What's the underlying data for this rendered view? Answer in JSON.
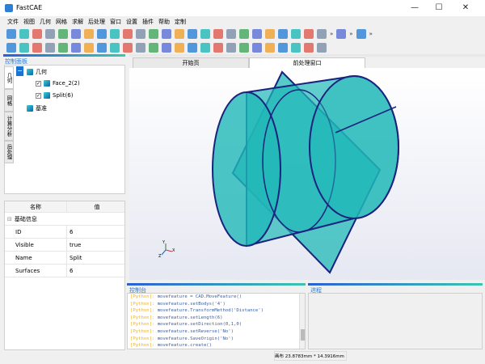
{
  "window": {
    "title": "FastCAE",
    "minimize": "—",
    "maximize": "☐",
    "close": "✕"
  },
  "menu": [
    "文件",
    "视图",
    "几何",
    "网格",
    "求解",
    "后处理",
    "窗口",
    "设置",
    "插件",
    "帮助",
    "定制"
  ],
  "toolbar1": [
    "new-file",
    "open-folder",
    "save",
    "import-geometry",
    "export-mesh",
    "calculator",
    "fit-view",
    "view-xy",
    "view-yx",
    "view-xz",
    "view-zx",
    "view-yz",
    "view-zy",
    "display-surface",
    "display-points",
    "display-edges",
    "display-faces",
    "select-point",
    "select-line",
    "select-face",
    "select-body",
    "box-select",
    "box-select-2",
    "grid-toggle",
    "cube-outline",
    "more",
    "mesh-cube",
    "more",
    "undo",
    "more"
  ],
  "toolbar2": [
    "sketch",
    "box",
    "cylinder",
    "cone",
    "sphere",
    "plane-triangle",
    "line",
    "points",
    "plane",
    "chamfer",
    "fillet",
    "variable-fillet",
    "boolean-union",
    "boolean-cut",
    "boolean-common",
    "mirror",
    "move",
    "rotate",
    "array",
    "extrude",
    "loft",
    "sweep",
    "revolve",
    "split",
    "measure"
  ],
  "left": {
    "title": "控制面板",
    "tabs": [
      "几何",
      "网格",
      "计算分析",
      "后处理"
    ],
    "tree": {
      "root": "几何",
      "children": [
        {
          "label": "Face_2(2)",
          "checked": true
        },
        {
          "label": "Split(6)",
          "checked": true
        }
      ],
      "other": "基准"
    }
  },
  "props": {
    "headers": [
      "名称",
      "值"
    ],
    "group": "基础信息",
    "rows": [
      {
        "k": "ID",
        "v": "6"
      },
      {
        "k": "Visible",
        "v": "true"
      },
      {
        "k": "Name",
        "v": "Split"
      },
      {
        "k": "Surfaces",
        "v": "6"
      }
    ]
  },
  "view": {
    "tabs": [
      "开始页",
      "前处理窗口"
    ],
    "active": 1
  },
  "console": {
    "title": "控制台",
    "lines": [
      {
        "tag": "[Python]:",
        "text": "movefeature = CAD.MoveFeature()"
      },
      {
        "tag": "[Python]:",
        "text": "movefeature.setBodys('4')"
      },
      {
        "tag": "[Python]:",
        "text": "movefeature.TransformMethod('Distance')"
      },
      {
        "tag": "[Python]:",
        "text": "movefeature.setLength(6)"
      },
      {
        "tag": "[Python]:",
        "text": "movefeature.setDirection(0,1,0)"
      },
      {
        "tag": "[Python]:",
        "text": "movefeature.setReverse('No')"
      },
      {
        "tag": "[Python]:",
        "text": "movefeature.SaveOrigin('No')"
      },
      {
        "tag": "[Python]:",
        "text": "movefeature.create()"
      }
    ]
  },
  "progress": {
    "title": "进程"
  },
  "status": {
    "canvas": "画布 23.8783mm * 14.3916mm"
  },
  "colors": {
    "accent": "#2a7bd2",
    "python_tag": "#f0b020",
    "model": "#20b8b8",
    "edges": "#1a237e"
  }
}
